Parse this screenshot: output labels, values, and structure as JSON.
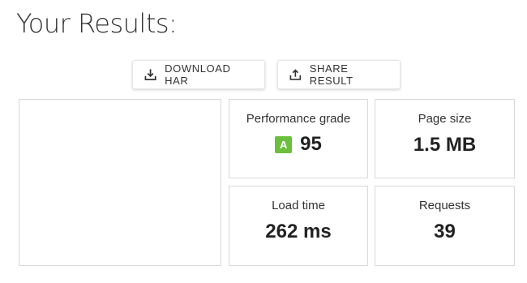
{
  "header": {
    "title": "Your Results:"
  },
  "actions": {
    "download_label": "DOWNLOAD HAR",
    "share_label": "SHARE RESULT"
  },
  "metrics": {
    "performance": {
      "label": "Performance grade",
      "grade": "A",
      "value": "95"
    },
    "page_size": {
      "label": "Page size",
      "value": "1.5 MB"
    },
    "load_time": {
      "label": "Load time",
      "value": "262 ms"
    },
    "requests": {
      "label": "Requests",
      "value": "39"
    }
  },
  "colors": {
    "grade_badge": "#6cbf3c",
    "border": "#d9d9d9"
  },
  "icons": {
    "download": "download-icon",
    "share": "share-icon"
  }
}
